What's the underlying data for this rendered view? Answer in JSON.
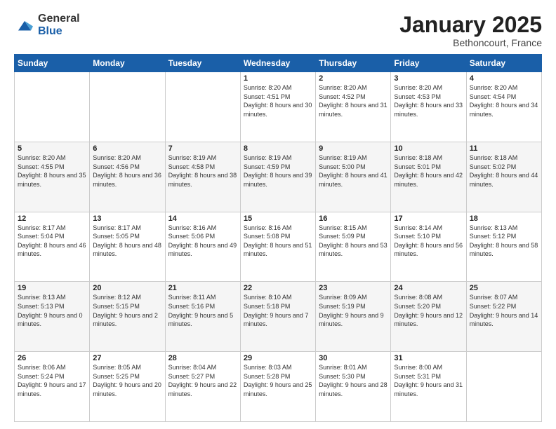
{
  "header": {
    "logo_general": "General",
    "logo_blue": "Blue",
    "month_title": "January 2025",
    "subtitle": "Bethoncourt, France"
  },
  "days_of_week": [
    "Sunday",
    "Monday",
    "Tuesday",
    "Wednesday",
    "Thursday",
    "Friday",
    "Saturday"
  ],
  "weeks": [
    [
      {
        "num": "",
        "info": ""
      },
      {
        "num": "",
        "info": ""
      },
      {
        "num": "",
        "info": ""
      },
      {
        "num": "1",
        "info": "Sunrise: 8:20 AM\nSunset: 4:51 PM\nDaylight: 8 hours\nand 30 minutes."
      },
      {
        "num": "2",
        "info": "Sunrise: 8:20 AM\nSunset: 4:52 PM\nDaylight: 8 hours\nand 31 minutes."
      },
      {
        "num": "3",
        "info": "Sunrise: 8:20 AM\nSunset: 4:53 PM\nDaylight: 8 hours\nand 33 minutes."
      },
      {
        "num": "4",
        "info": "Sunrise: 8:20 AM\nSunset: 4:54 PM\nDaylight: 8 hours\nand 34 minutes."
      }
    ],
    [
      {
        "num": "5",
        "info": "Sunrise: 8:20 AM\nSunset: 4:55 PM\nDaylight: 8 hours\nand 35 minutes."
      },
      {
        "num": "6",
        "info": "Sunrise: 8:20 AM\nSunset: 4:56 PM\nDaylight: 8 hours\nand 36 minutes."
      },
      {
        "num": "7",
        "info": "Sunrise: 8:19 AM\nSunset: 4:58 PM\nDaylight: 8 hours\nand 38 minutes."
      },
      {
        "num": "8",
        "info": "Sunrise: 8:19 AM\nSunset: 4:59 PM\nDaylight: 8 hours\nand 39 minutes."
      },
      {
        "num": "9",
        "info": "Sunrise: 8:19 AM\nSunset: 5:00 PM\nDaylight: 8 hours\nand 41 minutes."
      },
      {
        "num": "10",
        "info": "Sunrise: 8:18 AM\nSunset: 5:01 PM\nDaylight: 8 hours\nand 42 minutes."
      },
      {
        "num": "11",
        "info": "Sunrise: 8:18 AM\nSunset: 5:02 PM\nDaylight: 8 hours\nand 44 minutes."
      }
    ],
    [
      {
        "num": "12",
        "info": "Sunrise: 8:17 AM\nSunset: 5:04 PM\nDaylight: 8 hours\nand 46 minutes."
      },
      {
        "num": "13",
        "info": "Sunrise: 8:17 AM\nSunset: 5:05 PM\nDaylight: 8 hours\nand 48 minutes."
      },
      {
        "num": "14",
        "info": "Sunrise: 8:16 AM\nSunset: 5:06 PM\nDaylight: 8 hours\nand 49 minutes."
      },
      {
        "num": "15",
        "info": "Sunrise: 8:16 AM\nSunset: 5:08 PM\nDaylight: 8 hours\nand 51 minutes."
      },
      {
        "num": "16",
        "info": "Sunrise: 8:15 AM\nSunset: 5:09 PM\nDaylight: 8 hours\nand 53 minutes."
      },
      {
        "num": "17",
        "info": "Sunrise: 8:14 AM\nSunset: 5:10 PM\nDaylight: 8 hours\nand 56 minutes."
      },
      {
        "num": "18",
        "info": "Sunrise: 8:13 AM\nSunset: 5:12 PM\nDaylight: 8 hours\nand 58 minutes."
      }
    ],
    [
      {
        "num": "19",
        "info": "Sunrise: 8:13 AM\nSunset: 5:13 PM\nDaylight: 9 hours\nand 0 minutes."
      },
      {
        "num": "20",
        "info": "Sunrise: 8:12 AM\nSunset: 5:15 PM\nDaylight: 9 hours\nand 2 minutes."
      },
      {
        "num": "21",
        "info": "Sunrise: 8:11 AM\nSunset: 5:16 PM\nDaylight: 9 hours\nand 5 minutes."
      },
      {
        "num": "22",
        "info": "Sunrise: 8:10 AM\nSunset: 5:18 PM\nDaylight: 9 hours\nand 7 minutes."
      },
      {
        "num": "23",
        "info": "Sunrise: 8:09 AM\nSunset: 5:19 PM\nDaylight: 9 hours\nand 9 minutes."
      },
      {
        "num": "24",
        "info": "Sunrise: 8:08 AM\nSunset: 5:20 PM\nDaylight: 9 hours\nand 12 minutes."
      },
      {
        "num": "25",
        "info": "Sunrise: 8:07 AM\nSunset: 5:22 PM\nDaylight: 9 hours\nand 14 minutes."
      }
    ],
    [
      {
        "num": "26",
        "info": "Sunrise: 8:06 AM\nSunset: 5:24 PM\nDaylight: 9 hours\nand 17 minutes."
      },
      {
        "num": "27",
        "info": "Sunrise: 8:05 AM\nSunset: 5:25 PM\nDaylight: 9 hours\nand 20 minutes."
      },
      {
        "num": "28",
        "info": "Sunrise: 8:04 AM\nSunset: 5:27 PM\nDaylight: 9 hours\nand 22 minutes."
      },
      {
        "num": "29",
        "info": "Sunrise: 8:03 AM\nSunset: 5:28 PM\nDaylight: 9 hours\nand 25 minutes."
      },
      {
        "num": "30",
        "info": "Sunrise: 8:01 AM\nSunset: 5:30 PM\nDaylight: 9 hours\nand 28 minutes."
      },
      {
        "num": "31",
        "info": "Sunrise: 8:00 AM\nSunset: 5:31 PM\nDaylight: 9 hours\nand 31 minutes."
      },
      {
        "num": "",
        "info": ""
      }
    ]
  ]
}
